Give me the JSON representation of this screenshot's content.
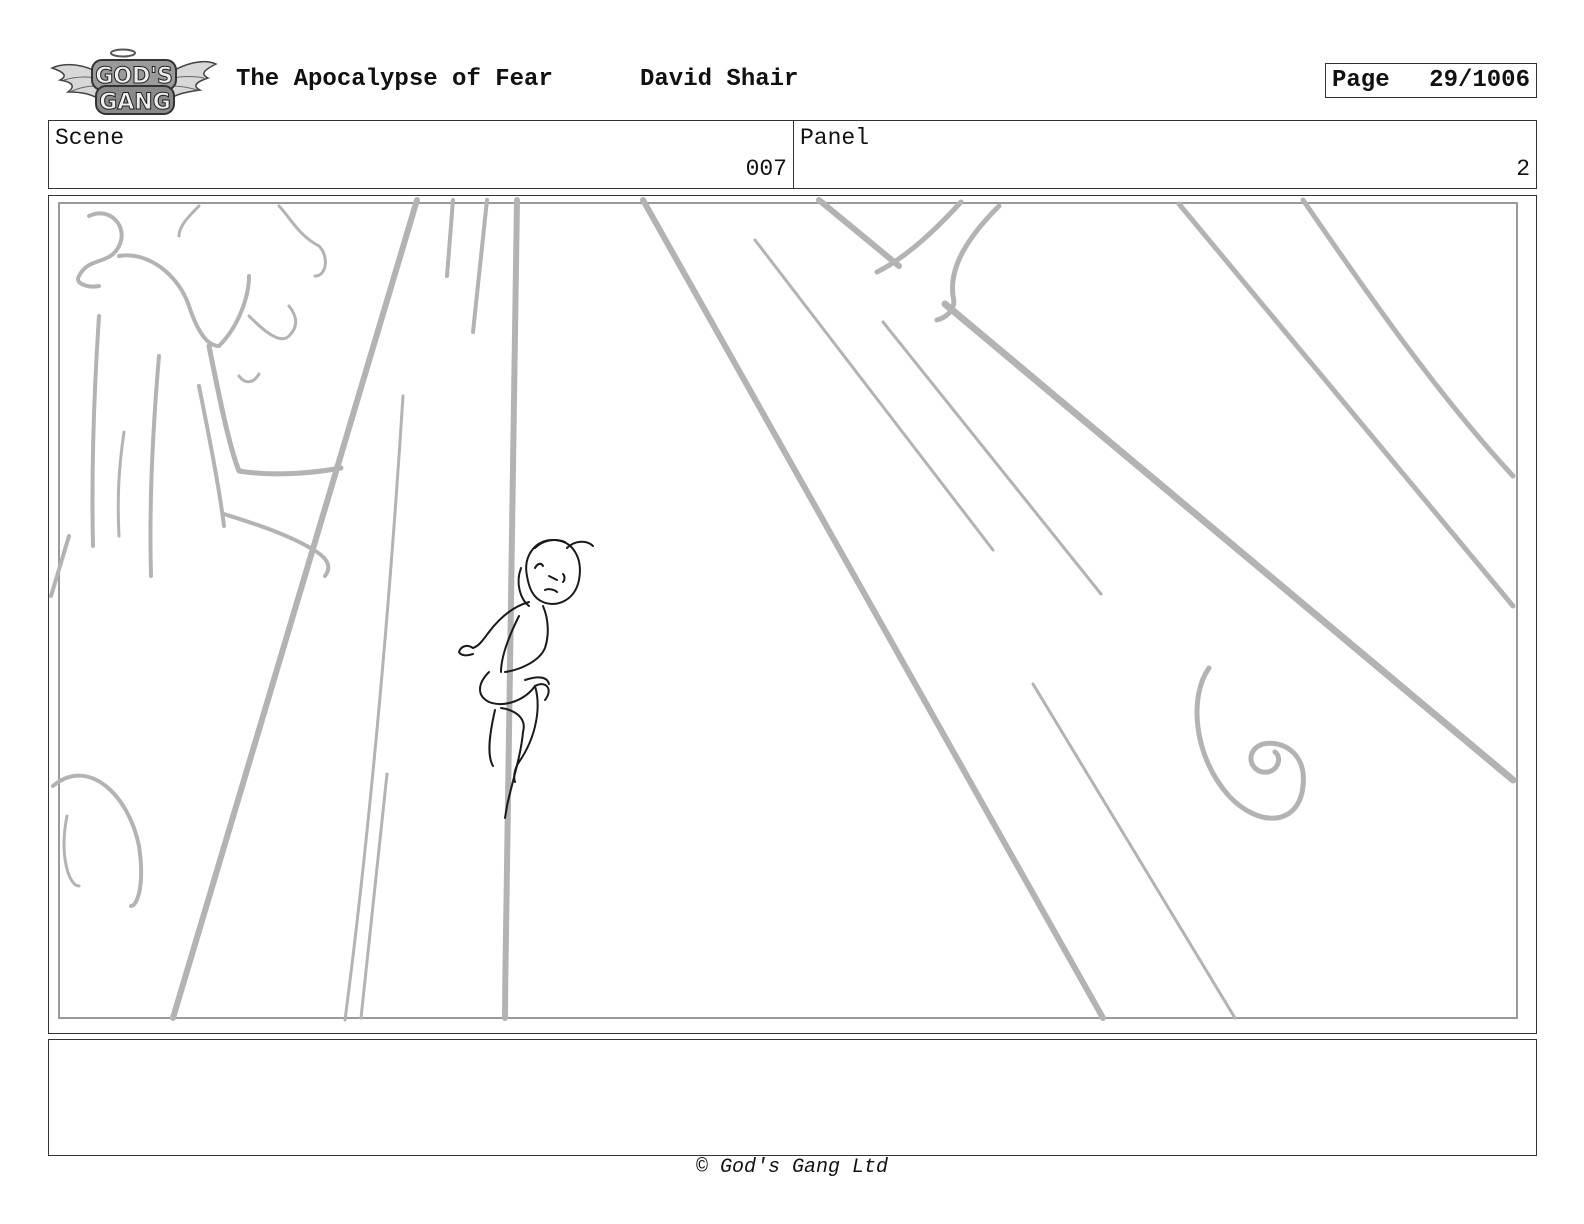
{
  "header": {
    "logo_text_top": "GOD'S",
    "logo_text_bottom": "GANG",
    "title": "The Apocalypse of Fear",
    "author": "David Shair",
    "page_label": "Page",
    "page_value": "29/1006"
  },
  "info": {
    "scene_label": "Scene",
    "scene_value": "007",
    "panel_label": "Panel",
    "panel_value": "2"
  },
  "panel": {
    "drawing": "pencil storyboard sketch",
    "colors": {
      "rough_lines": "#b0b0b0",
      "character_lines": "#1a1a1a"
    }
  },
  "notes": {
    "text": ""
  },
  "footer": {
    "copyright": "© God's Gang Ltd"
  }
}
